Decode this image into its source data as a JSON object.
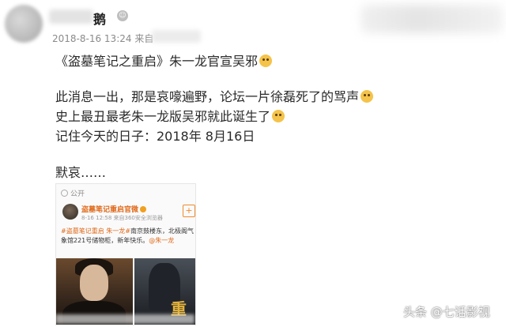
{
  "header": {
    "username_visible": "鹅",
    "timestamp": "2018-8-16 13:24",
    "source_prefix": "来自"
  },
  "post": {
    "line1": "《盗墓笔记之重启》朱一龙官宣吴邪",
    "line2": "此消息一出，那是哀嚎遍野，论坛一片徐磊死了的骂声",
    "line3": "史上最丑最老朱一龙版吴邪就此诞生了",
    "line4": "记住今天的日子：2018年 8月16日",
    "line5": "默哀……",
    "emoji_icon": "dog-face-emoji"
  },
  "embed": {
    "visibility": "公开",
    "account": "盗墓笔记重启官微",
    "meta": "8-16 12:58 来自360安全浏览器",
    "follow_symbol": "+",
    "text_prefix": "#盗墓笔记重启 朱一龙#",
    "text_body": "南京鼓楼东，北极阁气象馆221号储物柜，新年快乐。",
    "text_mention": "@朱一龙",
    "image_right_glyph": "重"
  },
  "watermark": "头条 @七话影视",
  "colors": {
    "link_orange": "#e06a1b",
    "meta_gray": "#8a8a8a",
    "text_dark": "#2a2a2a"
  }
}
